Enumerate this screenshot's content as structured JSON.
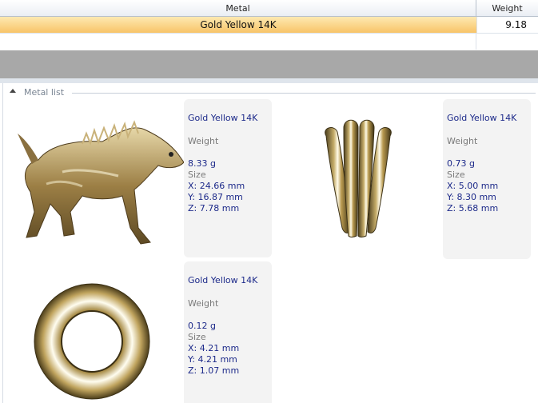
{
  "grid": {
    "columns": [
      "Metal",
      "Weight"
    ],
    "selected_row": {
      "metal": "Gold Yellow 14K",
      "weight": "9.18"
    }
  },
  "group": {
    "title": "Metal list"
  },
  "items": [
    {
      "metal": "Gold Yellow 14K",
      "weight_label": "Weight",
      "weight": "8.33 g",
      "size_label": "Size",
      "x": "X: 24.66 mm",
      "y": "Y: 16.87 mm",
      "z": "Z: 7.78 mm",
      "thumbnail": "hyena-model-icon"
    },
    {
      "metal": "Gold Yellow 14K",
      "weight_label": "Weight",
      "weight": "0.73 g",
      "size_label": "Size",
      "x": "X: 5.00 mm",
      "y": "Y: 8.30 mm",
      "z": "Z: 5.68 mm",
      "thumbnail": "prong-setting-icon"
    },
    {
      "metal": "Gold Yellow 14K",
      "weight_label": "Weight",
      "weight": "0.12 g",
      "size_label": "Size",
      "x": "X: 4.21 mm",
      "y": "Y: 4.21 mm",
      "z": "Z: 1.07 mm",
      "thumbnail": "ring-torus-icon"
    }
  ],
  "colors": {
    "selection_top": "#fde9b2",
    "selection_bottom": "#f8c468",
    "value_text": "#1d2a8a",
    "gold": "#b69a55"
  }
}
